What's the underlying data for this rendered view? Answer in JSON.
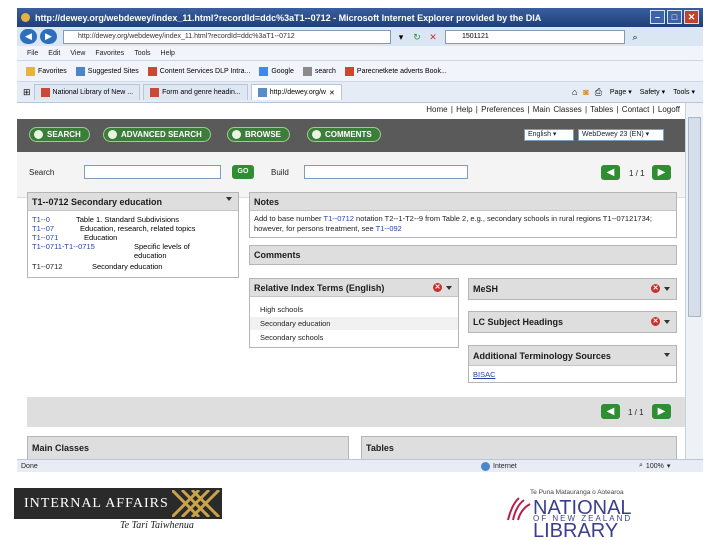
{
  "window": {
    "title": "http://dewey.org/webdewey/index_11.html?recordId=ddc%3aT1--0712 - Microsoft Internet Explorer provided by the DIA",
    "address": "http://dewey.org/webdewey/index_11.html?recordId=ddc%3aT1--0712",
    "search_value": "1501121",
    "menu": [
      "File",
      "Edit",
      "View",
      "Favorites",
      "Tools",
      "Help"
    ],
    "favorites": [
      "Favorites",
      "Suggested Sites",
      "Content Services DLP Intra...",
      "Google",
      "search",
      "Parecnetkete adverts Book..."
    ],
    "tabs": [
      "National Library of New ...",
      "Form and genre headin...",
      "http://dewey.org/w"
    ],
    "commands": [
      "Page",
      "Safety",
      "Tools"
    ],
    "status": "Done",
    "status_zone": "Internet",
    "zoom": "100%"
  },
  "app": {
    "top_links": "Home | Help | Preferences | Main Classes | Tables | Contact | Logoff",
    "buttons": [
      "SEARCH",
      "ADVANCED SEARCH",
      "BROWSE",
      "COMMENTS"
    ],
    "language": "English",
    "edition": "WebDewey 23 (EN)",
    "search_label": "Search",
    "search_go": "GO",
    "build_label": "Build",
    "pager": "1 / 1",
    "hierarchy_title": "T1--0712 Secondary education",
    "hierarchy": [
      {
        "num": "T1--0",
        "text": "Table 1. Standard Subdivisions"
      },
      {
        "num": "T1--07",
        "text": "Education, research, related topics"
      },
      {
        "num": "T1--071",
        "text": "Education"
      },
      {
        "num": "T1--0711-T1--0715",
        "text": "Specific levels of"
      },
      {
        "num": "",
        "text": "education"
      },
      {
        "num": "T1--0712",
        "text": "Secondary education"
      }
    ],
    "notes_title": "Notes",
    "notes_text_a": "Add to base number ",
    "notes_link_a": "T1--0712",
    "notes_text_b": " notation T2--1-T2--9 from Table 2, e.g., secondary schools in rural regions T1--07121734; however, for persons treatment, see ",
    "notes_link_b": "T1--092",
    "comments_title": "Comments",
    "relative_title": "Relative Index Terms (English)",
    "relative_terms": [
      "High schools",
      "Secondary education",
      "Secondary schools"
    ],
    "mesh_title": "MeSH",
    "lcsh_title": "LC Subject Headings",
    "additional_title": "Additional Terminology Sources",
    "additional_link": "BISAC",
    "main_classes_title": "Main Classes",
    "tables_title": "Tables"
  },
  "footer": {
    "ia_name": "INTERNAL AFFAIRS",
    "ia_sub": "Te Tari Taiwhenua",
    "nlnz_tag": "Te Puna Matauranga o Aotearoa",
    "nlnz_name": "NATIONAL LIBRARY",
    "nlnz_sub": "OF NEW ZEALAND"
  },
  "colors": {
    "accent_green": "#2f8d32",
    "toolbar_gray": "#5a5a5a",
    "link_blue": "#2244aa"
  }
}
